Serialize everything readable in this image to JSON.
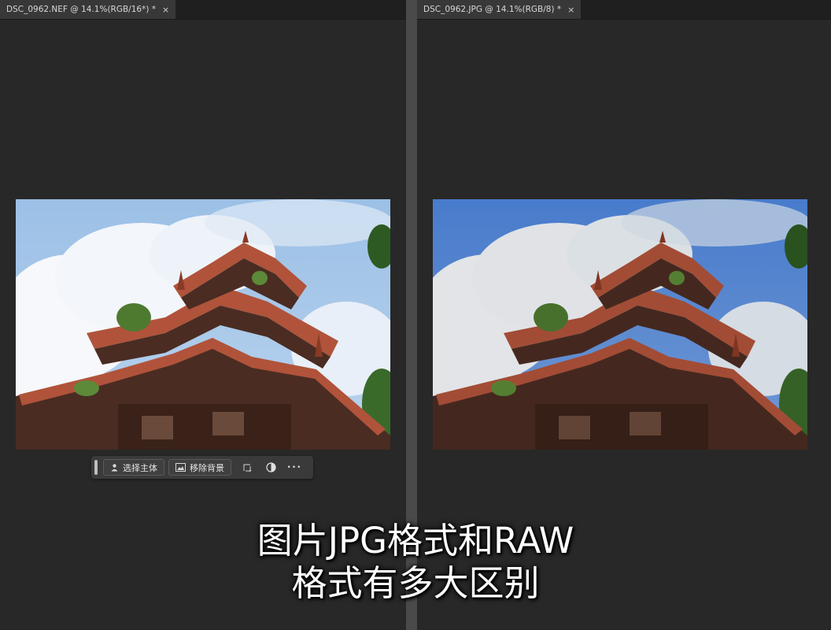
{
  "left_doc": {
    "tab_title": "DSC_0962.NEF @ 14.1%(RGB/16*) *",
    "close_glyph": "×"
  },
  "right_doc": {
    "tab_title": "DSC_0962.JPG @ 14.1%(RGB/8) *",
    "close_glyph": "×"
  },
  "contextual_taskbar": {
    "select_subject": "选择主体",
    "remove_background": "移除背景",
    "more_glyph": "•••",
    "icons": [
      "person-icon",
      "image-icon",
      "transform-icon",
      "adjustment-icon",
      "more-icon"
    ]
  },
  "caption": {
    "line1": "图片JPG格式和RAW",
    "line2": "格式有多大区别"
  },
  "colors": {
    "workspace": "#282828",
    "tab_active": "#383838",
    "divider": "#4a4a4a",
    "raw_sky": "#a9c9e8",
    "jpg_sky": "#5d8fe0",
    "roof_tile": "#b0533a",
    "wood": "#4a2c22"
  }
}
